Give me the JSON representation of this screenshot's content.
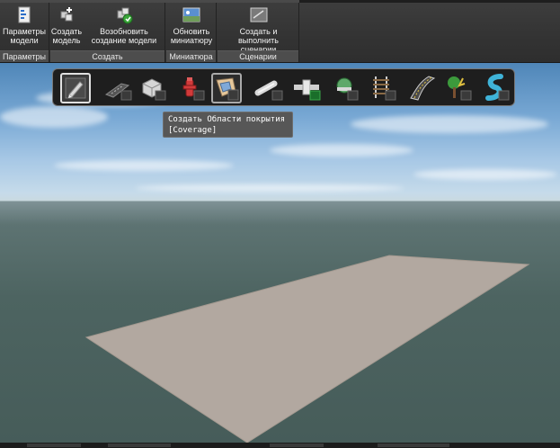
{
  "ribbon": {
    "panels": [
      {
        "title": "Параметры",
        "buttons": [
          {
            "label": "Параметры модели",
            "icon": "model-settings-icon"
          }
        ]
      },
      {
        "title": "Создать",
        "buttons": [
          {
            "label": "Создать модель",
            "icon": "create-model-icon"
          },
          {
            "label": "Возобновить создание модели",
            "icon": "resume-model-creation-icon"
          }
        ]
      },
      {
        "title": "Миниатюра",
        "buttons": [
          {
            "label": "Обновить миниатюру",
            "icon": "thumbnail-icon"
          }
        ]
      },
      {
        "title": "Сценарии",
        "buttons": [
          {
            "label": "Создать и выполнить сценарии",
            "icon": "scenario-icon"
          }
        ]
      }
    ]
  },
  "palette": {
    "tools": [
      {
        "name": "sketch-tool",
        "icon": "pencil-icon",
        "state": "selected"
      },
      {
        "name": "road-tool",
        "icon": "road-icon"
      },
      {
        "name": "building-tool",
        "icon": "building-icon"
      },
      {
        "name": "hydrant-tool",
        "icon": "hydrant-icon"
      },
      {
        "name": "coverage-tool",
        "icon": "coverage-area-icon",
        "state": "hover"
      },
      {
        "name": "pipe-tool",
        "icon": "pipe-icon"
      },
      {
        "name": "pipe-fitting-tool",
        "icon": "fitting-icon"
      },
      {
        "name": "pressure-pipe-tool",
        "icon": "pressure-network-icon"
      },
      {
        "name": "railway-tool",
        "icon": "railway-icon"
      },
      {
        "name": "bridge-tool",
        "icon": "bridge-icon"
      },
      {
        "name": "tree-tool",
        "icon": "tree-icon"
      },
      {
        "name": "river-tool",
        "icon": "river-icon"
      }
    ]
  },
  "tooltip": {
    "line1": "Создать Области покрытия",
    "line2": "[Coverage]"
  },
  "colors": {
    "ribbon_bg": "#333333",
    "panel_title_bg": "#4d4d4d",
    "palette_bg": "#1e1e1e",
    "tooltip_bg": "#575757",
    "surface": "#b2a8a0"
  }
}
